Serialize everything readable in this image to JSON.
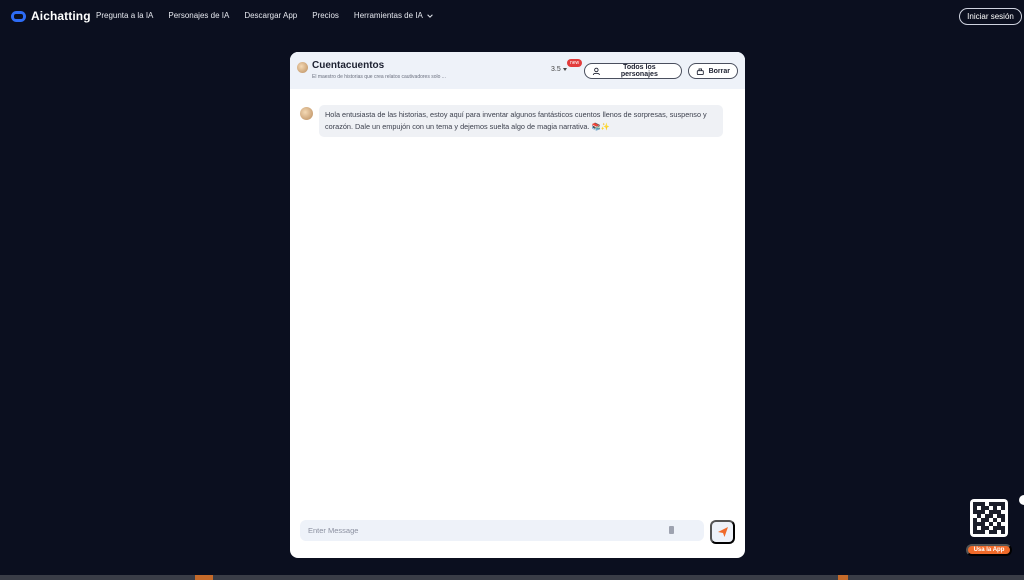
{
  "brand": {
    "name": "Aichatting"
  },
  "nav": {
    "items": [
      "Pregunta a la IA",
      "Personajes de IA",
      "Descargar App",
      "Precios",
      "Herramientas de IA"
    ],
    "login_label": "Iniciar sesión"
  },
  "chat": {
    "character_name": "Cuentacuentos",
    "character_desc": "El maestro de historias que crea relatos cautivadores solo ...",
    "model": "3.5",
    "new_badge": "new",
    "all_characters_label": "Todos los personajes",
    "clear_label": "Borrar",
    "message": "Hola entusiasta de las historias, estoy aquí para inventar algunos fantásticos cuentos llenos de sorpresas, suspenso y corazón. Dale un empujón con un tema y dejemos suelta algo de magia narrativa. 📚✨",
    "input_placeholder": "Enter Message"
  },
  "widget": {
    "app_label": "Usa la App"
  },
  "colors": {
    "background": "#0b0f1f",
    "accent": "#f06a2a",
    "badge": "#e23b3b",
    "header": "#eef2f9"
  },
  "icons": [
    "logo-icon",
    "chevron-down-icon",
    "person-icon",
    "broom-icon",
    "send-icon",
    "attach-icon",
    "qr-code-icon"
  ]
}
